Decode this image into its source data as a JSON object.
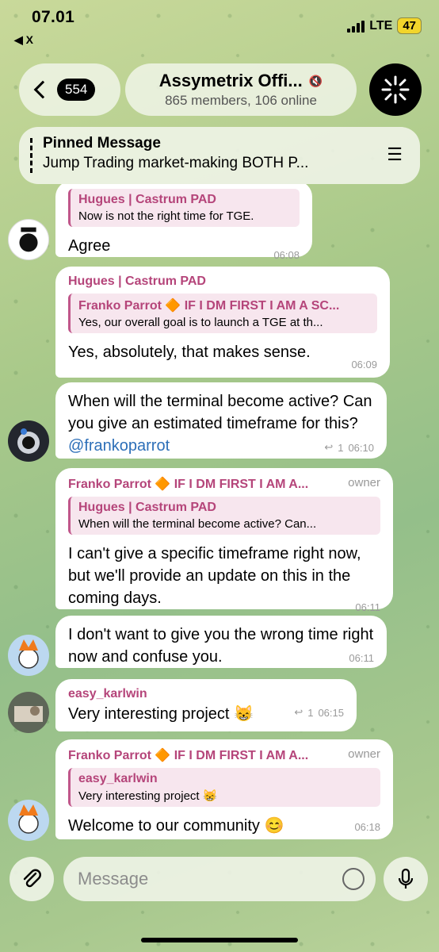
{
  "status": {
    "time": "07.01",
    "back_app": "◀ X",
    "network": "LTE",
    "battery": "47"
  },
  "header": {
    "unread_count": "554",
    "title": "Assymetrix Offi...",
    "subtitle": "865 members, 106 online"
  },
  "pinned": {
    "label": "Pinned Message",
    "text": "Jump Trading market-making BOTH P..."
  },
  "messages": [
    {
      "quote_name": "Hugues | Castrum PAD",
      "quote_text": "Now is not the right time for TGE.",
      "text": "Agree",
      "time": "06:08"
    },
    {
      "sender": "Hugues | Castrum PAD",
      "quote_name": "Franko Parrot 🔶 IF I DM FIRST I AM A SC...",
      "quote_text": "Yes, our overall goal is to launch a TGE at th...",
      "text": "Yes, absolutely, that makes sense.",
      "time": "06:09"
    },
    {
      "text_pre": "When will the terminal become active? Can you give an estimated timeframe for this?",
      "mention": "@frankoparrot",
      "replies": "1",
      "time": "06:10"
    },
    {
      "sender": "Franko Parrot 🔶 IF I DM FIRST I AM A...",
      "role": "owner",
      "quote_name": "Hugues | Castrum PAD",
      "quote_text": "When will the terminal become active? Can...",
      "text": "I can't give a specific timeframe right now, but we'll provide an update on this in the coming days.",
      "time": "06:11"
    },
    {
      "text": "I don't want to give you the wrong time right now and confuse you.",
      "time": "06:11"
    },
    {
      "sender": "easy_karlwin",
      "text": "Very interesting project 😸",
      "replies": "1",
      "time": "06:15"
    },
    {
      "sender": "Franko Parrot 🔶 IF I DM FIRST I AM A...",
      "role": "owner",
      "quote_name": "easy_karlwin",
      "quote_text": "Very interesting project 😸",
      "text": "Welcome to our community 😊",
      "time": "06:18"
    }
  ],
  "input": {
    "placeholder": "Message"
  },
  "colors": {
    "accent_name": "#b5457a",
    "link": "#2d6fb8",
    "battery": "#f2d52b"
  }
}
